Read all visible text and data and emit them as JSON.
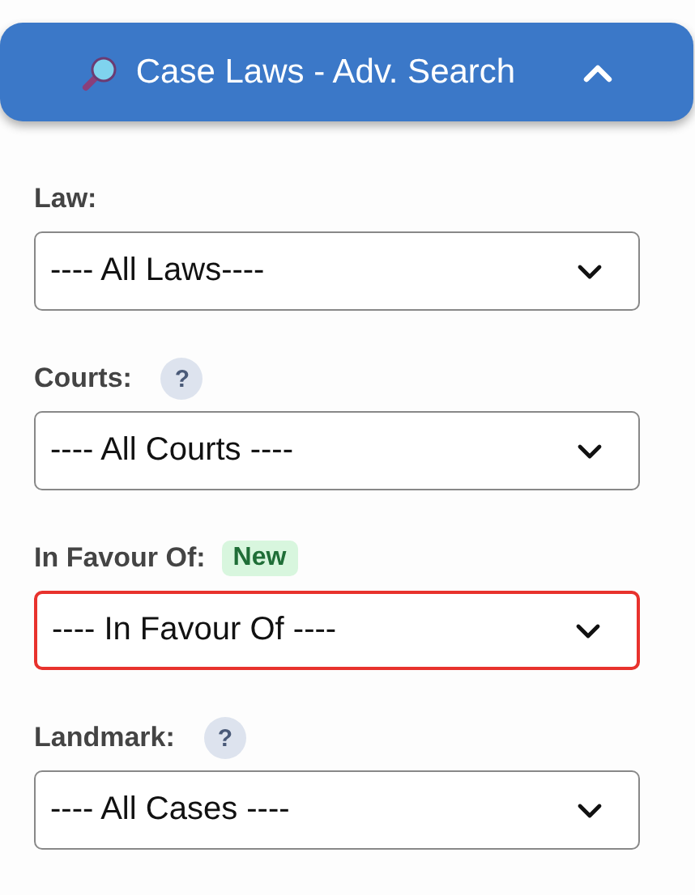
{
  "header": {
    "title": "Case Laws - Adv. Search",
    "expanded": true
  },
  "fields": [
    {
      "label": "Law:",
      "value": "---- All Laws----",
      "highlighted": false
    },
    {
      "label": "Courts:",
      "help_text": "?",
      "value": "---- All Courts ----",
      "highlighted": false
    },
    {
      "label": "In Favour Of:",
      "badge": "New",
      "value": "---- In Favour Of ----",
      "highlighted": true
    },
    {
      "label": "Landmark:",
      "help_text": "?",
      "value": "---- All Cases ----",
      "highlighted": false
    }
  ]
}
